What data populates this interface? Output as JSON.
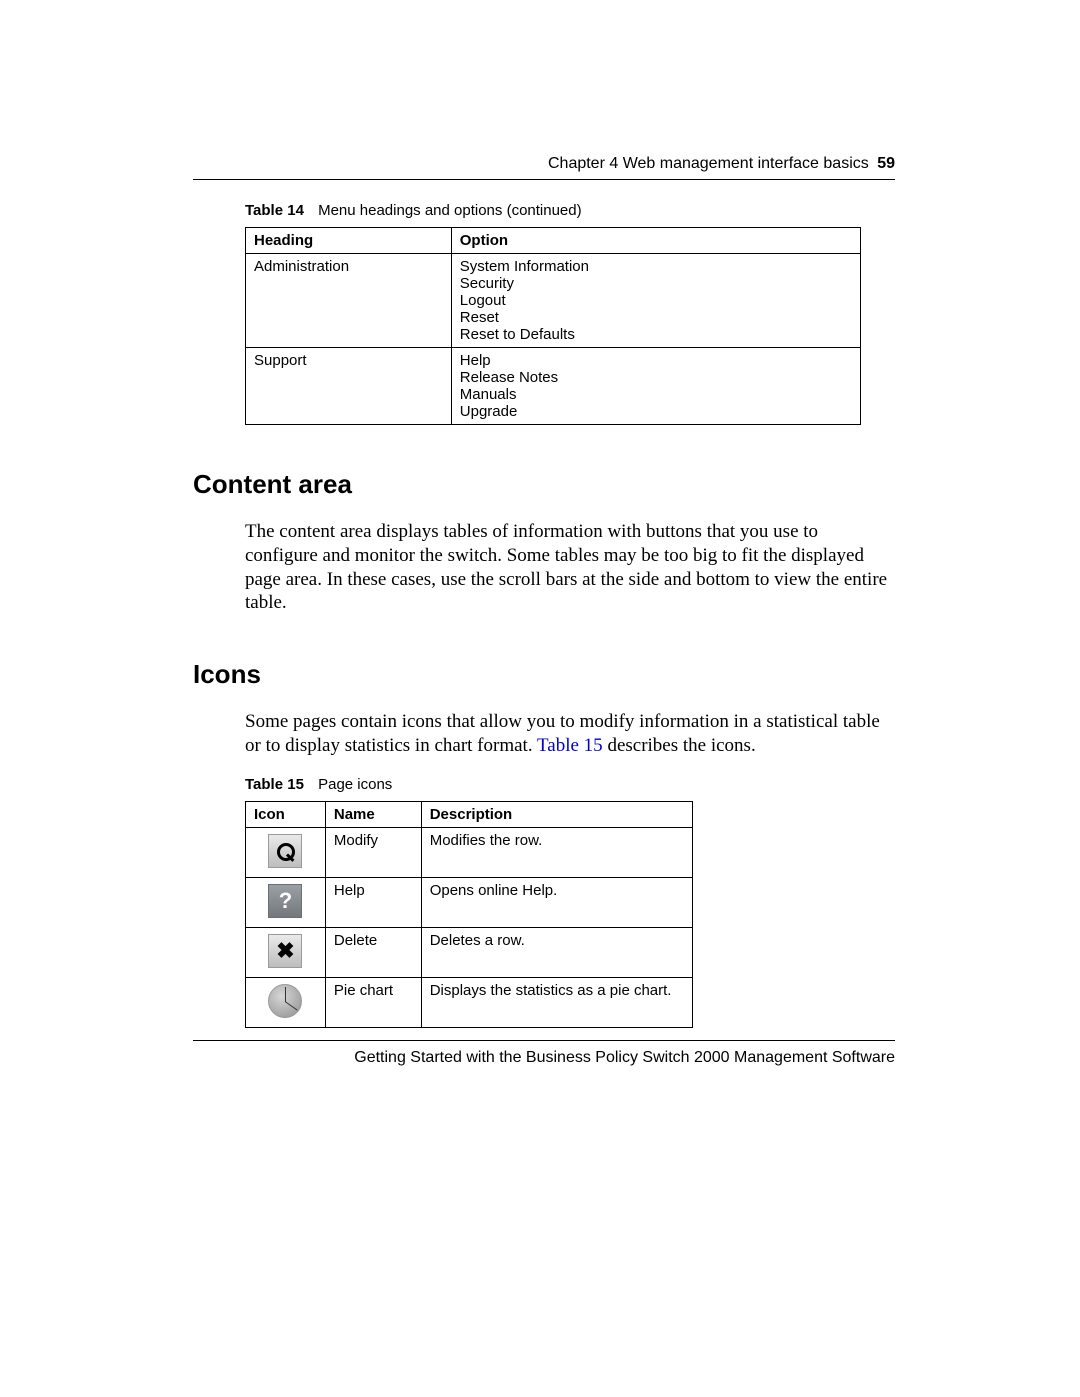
{
  "header": {
    "chapter_line": "Chapter 4  Web management interface basics",
    "page_number": "59"
  },
  "table14": {
    "caption_label": "Table 14",
    "caption_text": "Menu headings and options (continued)",
    "headers": {
      "c1": "Heading",
      "c2": "Option"
    },
    "rows": [
      {
        "heading": "Administration",
        "options": [
          "System Information",
          "Security",
          "Logout",
          "Reset",
          "Reset to Defaults"
        ]
      },
      {
        "heading": "Support",
        "options": [
          "Help",
          "Release Notes",
          "Manuals",
          "Upgrade"
        ]
      }
    ]
  },
  "sections": {
    "content_area": {
      "title": "Content area",
      "para": "The content area displays tables of information with buttons that you use to configure and monitor the switch. Some tables may be too big to fit the displayed page area. In these cases, use the scroll bars at the side and bottom to view the entire table."
    },
    "icons": {
      "title": "Icons",
      "para_before_link": "Some pages contain icons that allow you to modify information in a statistical table or to display statistics in chart format. ",
      "link_text": "Table 15",
      "para_after_link": " describes the icons."
    }
  },
  "table15": {
    "caption_label": "Table 15",
    "caption_text": "Page icons",
    "headers": {
      "c1": "Icon",
      "c2": "Name",
      "c3": "Description"
    },
    "rows": [
      {
        "icon": "modify",
        "name": "Modify",
        "desc": "Modifies the row."
      },
      {
        "icon": "help",
        "name": "Help",
        "desc": "Opens online Help."
      },
      {
        "icon": "delete",
        "name": "Delete",
        "desc": "Deletes a row."
      },
      {
        "icon": "pie",
        "name": "Pie chart",
        "desc": "Displays the statistics as a pie chart."
      }
    ]
  },
  "footer": {
    "text": "Getting Started with the Business Policy Switch 2000 Management Software"
  }
}
